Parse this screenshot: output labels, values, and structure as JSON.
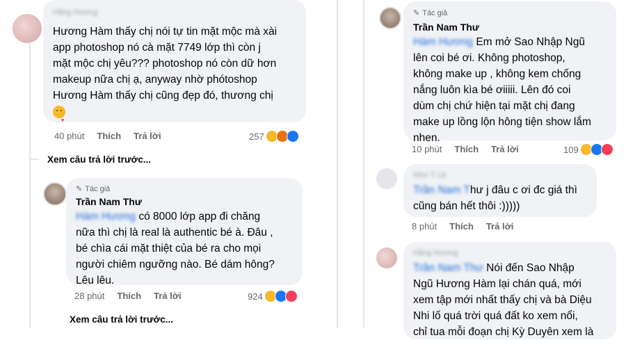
{
  "left": {
    "comment1": {
      "text": "Hương Hàm thấy chị nói tự tin mặt mộc mà xài app photoshop nó cà mặt 7749 lớp thì còn j mặt mộc chị yêu??? photoshop nó còn dữ hơn makeup nữa chị ạ, anyway nhờ phótoshop Hương Hàm thấy chị cũng đẹp đó, thương chị",
      "line1": "Hương Hàm thấy chị nói tự tin mặt mộc mà xài",
      "line2": "app photoshop nó cà mặt 7749 lớp thì còn j",
      "line3": "mặt mộc chị yêu??? photoshop nó còn dữ hơn",
      "line4": "makeup nữa chị ạ, anyway nhờ phótoshop",
      "line5": "Hương Hàm thấy chị cũng đẹp đó, thương chị",
      "time": "40 phút",
      "like": "Thích",
      "reply": "Trả lời",
      "reactions": "257"
    },
    "see_previous_1": "Xem câu trả lời trước...",
    "comment2": {
      "badge": "Tác giả",
      "author": "Trần Nam Thư",
      "line1_rest": "có 8000 lớp app đi chăng",
      "line2": "nữa thì chị là real là authentic bé à. Đâu ,",
      "line3": "bé chìa cái mặt thiệt của bé ra cho mọi",
      "line4": "người chiêm ngưỡng nào. Bé dám hông?",
      "line5": "Lêu lêu.",
      "time": "28 phút",
      "like": "Thích",
      "reply": "Trả lời",
      "reactions": "924"
    },
    "see_previous_2": "Xem câu trả lời trước..."
  },
  "right": {
    "comment1": {
      "badge": "Tác giả",
      "author": "Trần Nam Thư",
      "line1_rest": "Em mở Sao Nhập Ngũ",
      "line2": "lên coi bé ơi. Không photoshop,",
      "line3": "không make up , không kem chống",
      "line4": "nắng luôn kìa bé ơiiiii. Lên đó coi",
      "line5": "dùm chị chứ hiện tại mặt chị đang",
      "line6": "make up lồng lộn hông tiện show lắm",
      "line7": "nhen.",
      "time": "10 phút",
      "like": "Thích",
      "reply": "Trả lời",
      "reactions": "109"
    },
    "comment2": {
      "line1_rest": "hư j đâu c ơi đc giá thì",
      "line2": "cũng bán hết thôi :)))))",
      "time": "8 phút",
      "like": "Thích",
      "reply": "Trả lời"
    },
    "comment3": {
      "line1_rest": "Nói đến Sao Nhập",
      "line2": "Ngũ Hương Hàm lại chán quá, mới",
      "line3": "xem tập mới nhất thấy chị và bà Diệu",
      "line4": "Nhi lố quá trời quá đất ko xem nổi,",
      "line5": "chỉ tua mỗi đoạn chị Kỳ Duyên xem là"
    }
  },
  "colors": {
    "bubble": "#f0f2f5",
    "meta": "#65676b",
    "mention": "#216fdb",
    "like_blue": "#1877f2",
    "haha_yellow": "#f7b928",
    "angry_orange": "#e9710f",
    "love_red": "#f33e58"
  },
  "icons": [
    "pen-icon",
    "haha-reaction-icon",
    "angry-reaction-icon",
    "like-reaction-icon",
    "love-reaction-icon",
    "kissing-emoji-icon"
  ]
}
